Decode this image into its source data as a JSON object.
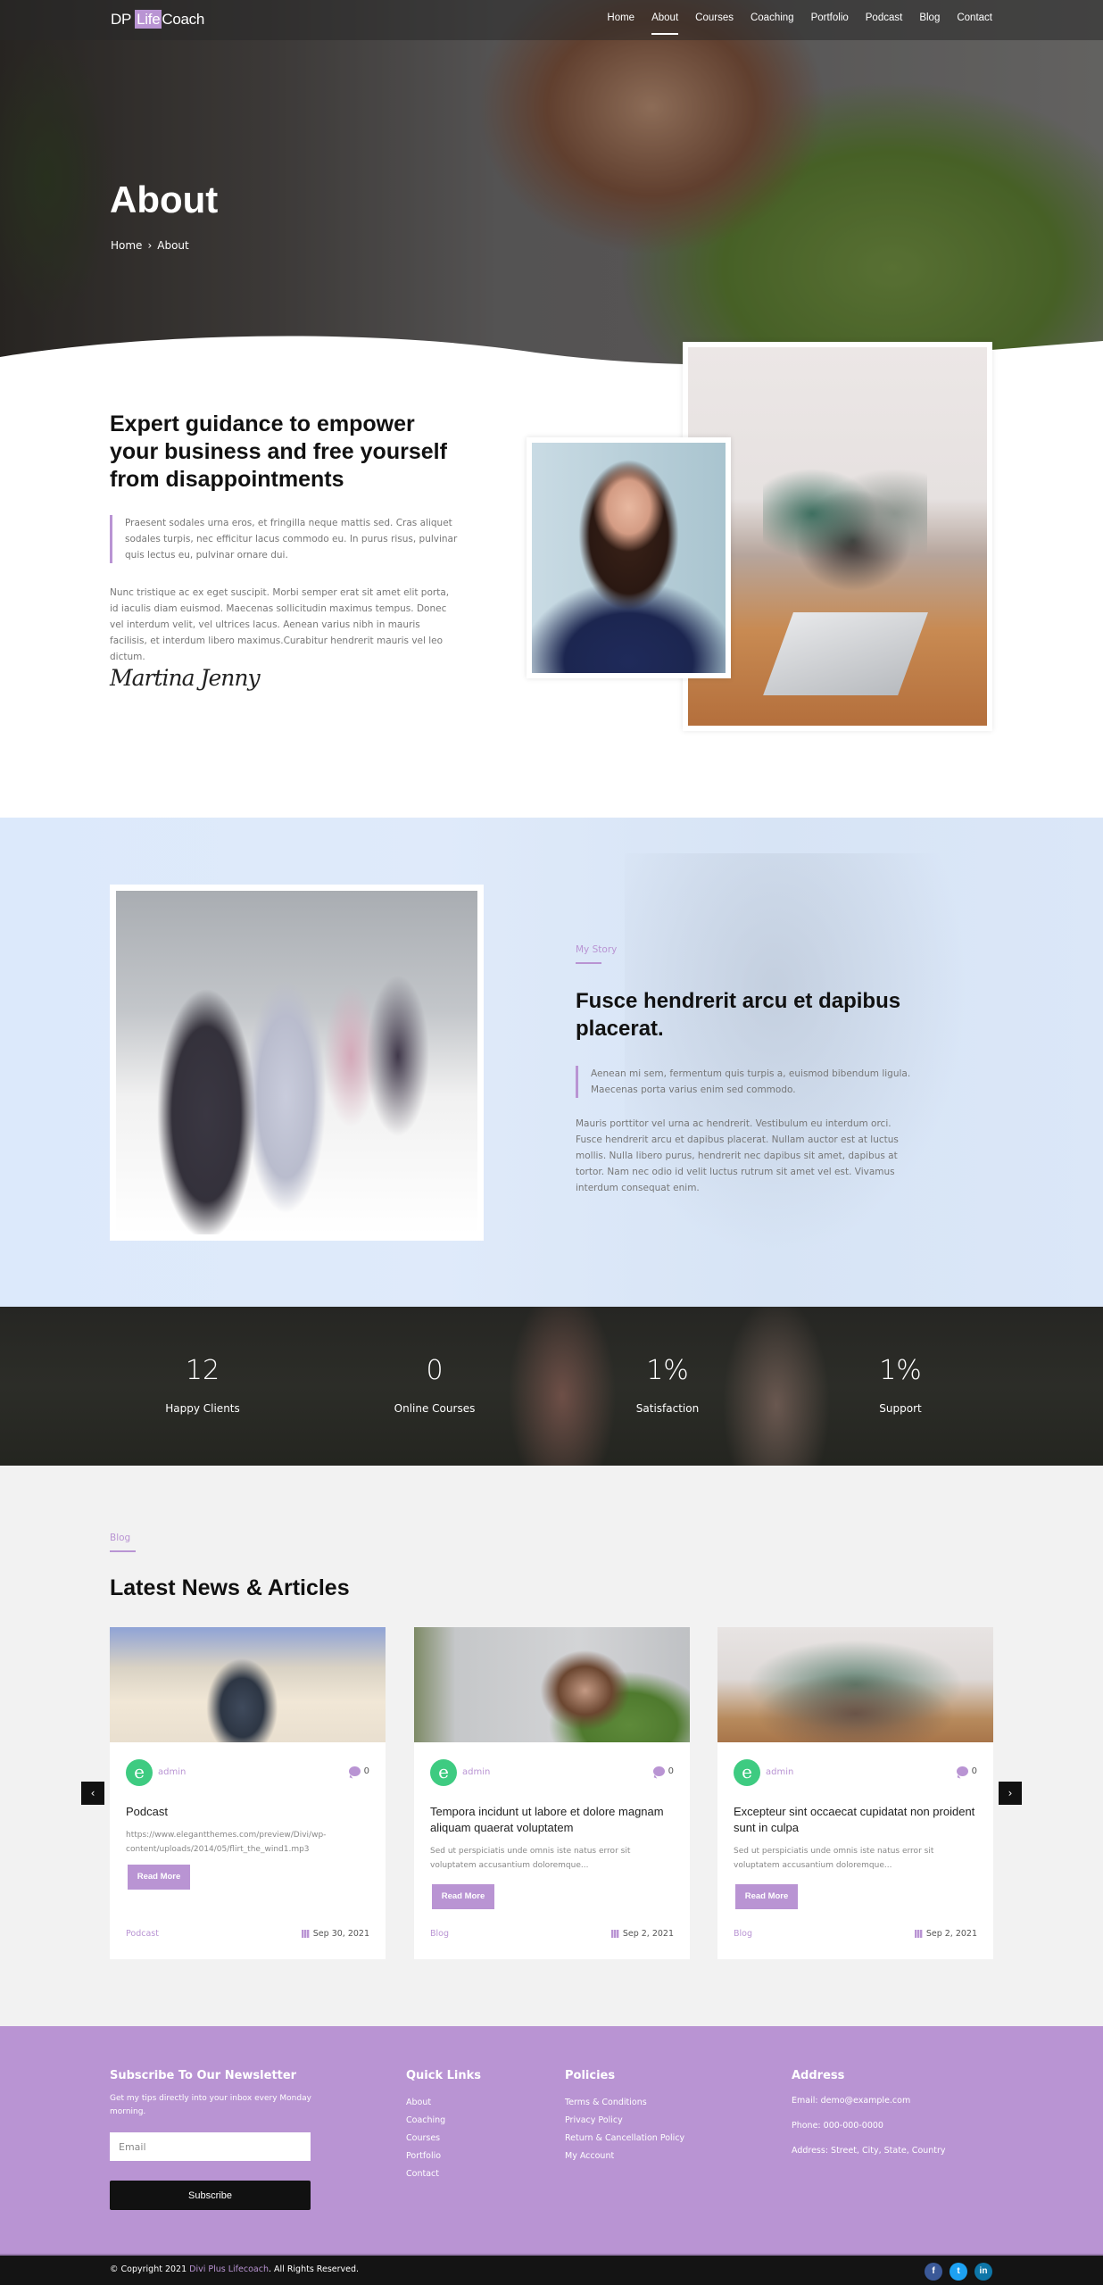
{
  "header": {
    "logo": {
      "prefix": "DP",
      "highlight": "Life",
      "suffix": "Coach"
    },
    "nav": [
      {
        "label": "Home",
        "active": false
      },
      {
        "label": "About",
        "active": true
      },
      {
        "label": "Courses",
        "active": false
      },
      {
        "label": "Coaching",
        "active": false
      },
      {
        "label": "Portfolio",
        "active": false
      },
      {
        "label": "Podcast",
        "active": false
      },
      {
        "label": "Blog",
        "active": false
      },
      {
        "label": "Contact",
        "active": false
      }
    ]
  },
  "hero": {
    "title": "About",
    "breadcrumb": {
      "home": "Home",
      "separator": "›",
      "current": "About"
    }
  },
  "about": {
    "heading": "Expert guidance to empower your business and free yourself from disappointments",
    "quote": "Praesent sodales urna eros, et fringilla neque mattis sed. Cras aliquet sodales turpis, nec efficitur lacus commodo eu. In purus risus, pulvinar quis lectus eu, pulvinar ornare dui.",
    "paragraph": "Nunc tristique ac ex eget suscipit. Morbi semper erat sit amet elit porta, id iaculis diam euismod. Maecenas sollicitudin maximus tempus. Donec vel interdum velit, vel ultrices lacus. Aenean varius nibh in mauris facilisis, et interdum libero maximus.Curabitur hendrerit mauris vel leo dictum.",
    "signature": "Martina Jenny"
  },
  "story": {
    "eyebrow": "My Story",
    "heading": "Fusce hendrerit arcu et dapibus placerat.",
    "quote": "Aenean mi sem, fermentum quis turpis a, euismod bibendum ligula. Maecenas porta varius enim sed commodo.",
    "paragraph": "Mauris porttitor vel urna ac hendrerit. Vestibulum eu interdum orci. Fusce hendrerit arcu et dapibus placerat. Nullam auctor est at luctus mollis. Nulla libero purus, hendrerit nec dapibus sit amet, dapibus at tortor. Nam nec odio id velit luctus rutrum sit amet vel est. Vivamus interdum consequat enim."
  },
  "stats": [
    {
      "value": "12",
      "label": "Happy Clients"
    },
    {
      "value": "0",
      "label": "Online Courses"
    },
    {
      "value": "1%",
      "label": "Satisfaction"
    },
    {
      "value": "1%",
      "label": "Support"
    }
  ],
  "blog": {
    "eyebrow": "Blog",
    "heading": "Latest News & Articles",
    "prev_icon": "‹",
    "next_icon": "›",
    "posts": [
      {
        "avatar_letter": "e",
        "author": "admin",
        "comments": "0",
        "title": "Podcast",
        "excerpt": "https://www.elegantthemes.com/preview/Divi/wp-content/uploads/2014/05/flirt_the_wind1.mp3",
        "button": "Read More",
        "category": "Podcast",
        "date": "Sep 30, 2021"
      },
      {
        "avatar_letter": "e",
        "author": "admin",
        "comments": "0",
        "title": "Tempora incidunt ut labore et dolore magnam aliquam quaerat voluptatem",
        "excerpt": "Sed ut perspiciatis unde omnis iste natus error sit voluptatem accusantium doloremque...",
        "button": "Read More",
        "category": "Blog",
        "date": "Sep 2, 2021"
      },
      {
        "avatar_letter": "e",
        "author": "admin",
        "comments": "0",
        "title": "Excepteur sint occaecat cupidatat non proident sunt in culpa",
        "excerpt": "Sed ut perspiciatis unde omnis iste natus error sit voluptatem accusantium doloremque...",
        "button": "Read More",
        "category": "Blog",
        "date": "Sep 2, 2021"
      }
    ]
  },
  "footer": {
    "newsletter": {
      "heading": "Subscribe To Our Newsletter",
      "subtext": "Get my tips directly into your inbox every Monday morning.",
      "email_placeholder": "Email",
      "button": "Subscribe"
    },
    "quick_links": {
      "heading": "Quick Links",
      "items": [
        "About",
        "Coaching",
        "Courses",
        "Portfolio",
        "Contact"
      ]
    },
    "policies": {
      "heading": "Policies",
      "items": [
        "Terms & Conditions",
        "Privacy Policy",
        "Return & Cancellation Policy",
        "My Account"
      ]
    },
    "address": {
      "heading": "Address",
      "email": "Email: demo@example.com",
      "phone": "Phone: 000-000-0000",
      "address": "Address: Street, City, State, Country"
    },
    "copyright": {
      "prefix": "© Copyright 2021 ",
      "brand": "Divi Plus Lifecoach",
      "suffix": ". All Rights Reserved."
    },
    "socials": [
      {
        "name": "facebook",
        "glyph": "f",
        "color": "#3b5998"
      },
      {
        "name": "twitter",
        "glyph": "t",
        "color": "#1da1f2"
      },
      {
        "name": "linkedin",
        "glyph": "in",
        "color": "#0e76a8"
      }
    ]
  },
  "theme": {
    "accent": "#b994d3",
    "dark": "#111111",
    "avatar": "#3ecb81"
  }
}
